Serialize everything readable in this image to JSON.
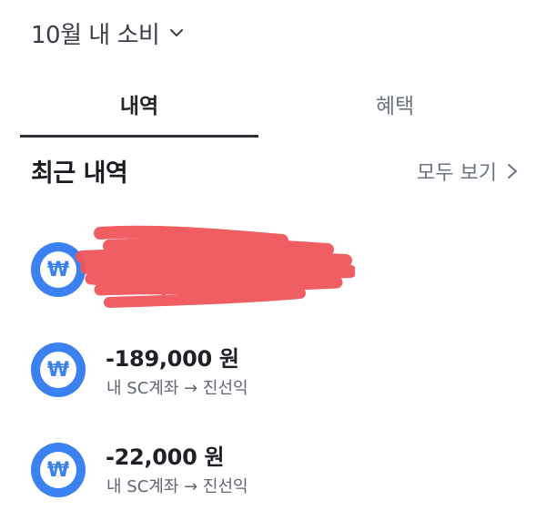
{
  "header": {
    "month_label": "10월 내 소비",
    "dropdown_icon": "chevron-down-icon"
  },
  "tabs": [
    {
      "label": "내역",
      "active": true
    },
    {
      "label": "혜택",
      "active": false
    }
  ],
  "section": {
    "title": "최근 내역",
    "see_all_label": "모두 보기",
    "see_all_icon": "chevron-right-icon"
  },
  "transactions": [
    {
      "icon": "won-icon",
      "amount": "",
      "description": "",
      "redacted": true
    },
    {
      "icon": "won-icon",
      "amount": "-189,000 원",
      "description": "내 SC계좌 → 진선익",
      "redacted": false
    },
    {
      "icon": "won-icon",
      "amount": "-22,000 원",
      "description": "내 SC계좌 → 진선익",
      "redacted": false
    }
  ],
  "icon_glyph": "₩",
  "colors": {
    "accent_blue": "#3b82f0",
    "redaction_red": "#f0555a",
    "text_primary": "#1d2026",
    "text_secondary": "#6b7480"
  }
}
